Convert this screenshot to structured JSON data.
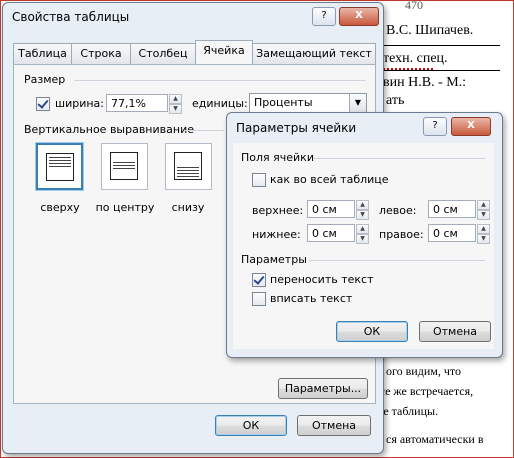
{
  "background_doc": {
    "lines": [
      "В.С. Шипачев.",
      "техн. спец.",
      "вин Н.В. - М.:",
      "ать",
      "ого видим, что",
      "все же встречается,",
      "ее таблицы.",
      "ся автоматически в"
    ],
    "partial_top": "470"
  },
  "main_dialog": {
    "title": "Свойства таблицы",
    "help_btn": "?",
    "close_btn": "X",
    "tabs": [
      "Таблица",
      "Строка",
      "Столбец",
      "Ячейка",
      "Замещающий текст"
    ],
    "active_tab": "Ячейка",
    "size_group": "Размер",
    "width_checkbox_label": "ширина:",
    "width_value": "77,1%",
    "units_label": "единицы:",
    "units_value": "Проценты",
    "valign_group": "Вертикальное выравнивание",
    "valign_options": [
      "сверху",
      "по центру",
      "снизу"
    ],
    "params_button": "Параметры...",
    "ok_button": "ОК",
    "cancel_button": "Отмена"
  },
  "cell_dialog": {
    "title": "Параметры ячейки",
    "help_btn": "?",
    "close_btn": "X",
    "margins_group": "Поля ячейки",
    "same_as_table_label": "как во всей таблице",
    "top_label": "верхнее:",
    "top_value": "0 см",
    "left_label": "левое:",
    "left_value": "0 см",
    "bottom_label": "нижнее:",
    "bottom_value": "0 см",
    "right_label": "правое:",
    "right_value": "0 см",
    "params_group": "Параметры",
    "wrap_text_label": "переносить текст",
    "fit_text_label": "вписать текст",
    "ok_button": "ОК",
    "cancel_button": "Отмена"
  },
  "colors": {
    "dialog_bg": "#e8eef6",
    "accent": "#3c7fb1"
  }
}
